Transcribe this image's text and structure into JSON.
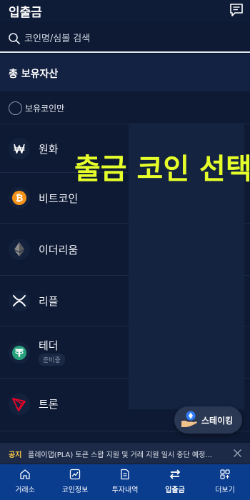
{
  "header": {
    "title": "입출금",
    "chat_icon": "chat-list-icon"
  },
  "search": {
    "placeholder": "코인명/심볼 검색",
    "icon": "search-icon"
  },
  "total": {
    "title": "총 보유자산"
  },
  "filter": {
    "label": "보유코인만",
    "checked": false
  },
  "coins": [
    {
      "name": "원화",
      "icon": "krw-icon",
      "color": "#ffffff"
    },
    {
      "name": "비트코인",
      "icon": "bitcoin-icon",
      "color": "#f7931a"
    },
    {
      "name": "이더리움",
      "icon": "ethereum-icon",
      "color": "#8c8c8c"
    },
    {
      "name": "리플",
      "icon": "xrp-icon",
      "color": "#ffffff"
    },
    {
      "name": "테더",
      "icon": "tether-icon",
      "color": "#26a17b",
      "badge": "준비중"
    },
    {
      "name": "트론",
      "icon": "tron-icon",
      "color": "#ef0027"
    }
  ],
  "overlay": {
    "text": "출금 코인 선택"
  },
  "staking": {
    "label": "스테이킹",
    "icon": "staking-hand-icon"
  },
  "notice": {
    "tag": "공지",
    "text": "플레이댑(PLA) 토큰 스왑 지원 및 거래 지원 일시 중단 예정...",
    "close_icon": "close-icon"
  },
  "nav": [
    {
      "label": "거래소",
      "icon": "home-icon",
      "active": false
    },
    {
      "label": "코인정보",
      "icon": "chart-icon",
      "active": false
    },
    {
      "label": "투자내역",
      "icon": "document-icon",
      "active": false
    },
    {
      "label": "입출금",
      "icon": "transfer-icon",
      "active": true
    },
    {
      "label": "더보기",
      "icon": "more-grid-icon",
      "active": false
    }
  ],
  "colors": {
    "background": "#0e1a33",
    "highlight": "#e6ff2a",
    "nav_background": "#0b3d8f",
    "notice_tag": "#f7c948"
  }
}
